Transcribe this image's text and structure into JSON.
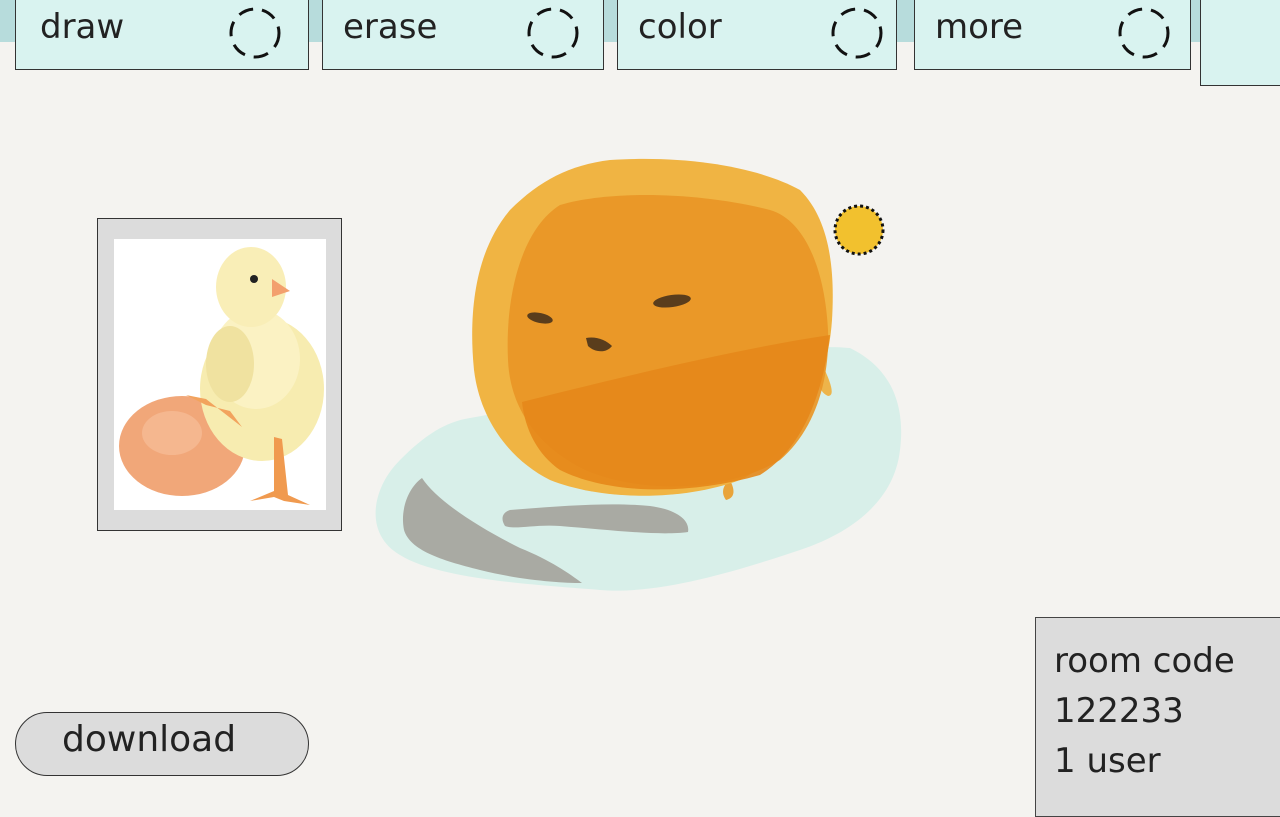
{
  "toolbar": {
    "tabs": [
      {
        "label": "draw",
        "icon": "dashed-circle-icon"
      },
      {
        "label": "erase",
        "icon": "dashed-circle-icon"
      },
      {
        "label": "color",
        "icon": "dashed-circle-icon"
      },
      {
        "label": "more",
        "icon": "dashed-circle-icon"
      }
    ]
  },
  "canvas": {
    "reference_image": "chick-and-egg-photo",
    "selected_color": "#f2c12e",
    "drawing_colors": {
      "body_outer": "#f0b443",
      "body_inner": "#e99626",
      "body_lower": "#e6871a",
      "shadow": "#d8efe9",
      "legs": "#a9aaa3",
      "face": "#5a3d1c"
    }
  },
  "footer": {
    "download_label": "download"
  },
  "room": {
    "title": "room code",
    "code": "122233",
    "users": "1 user"
  }
}
